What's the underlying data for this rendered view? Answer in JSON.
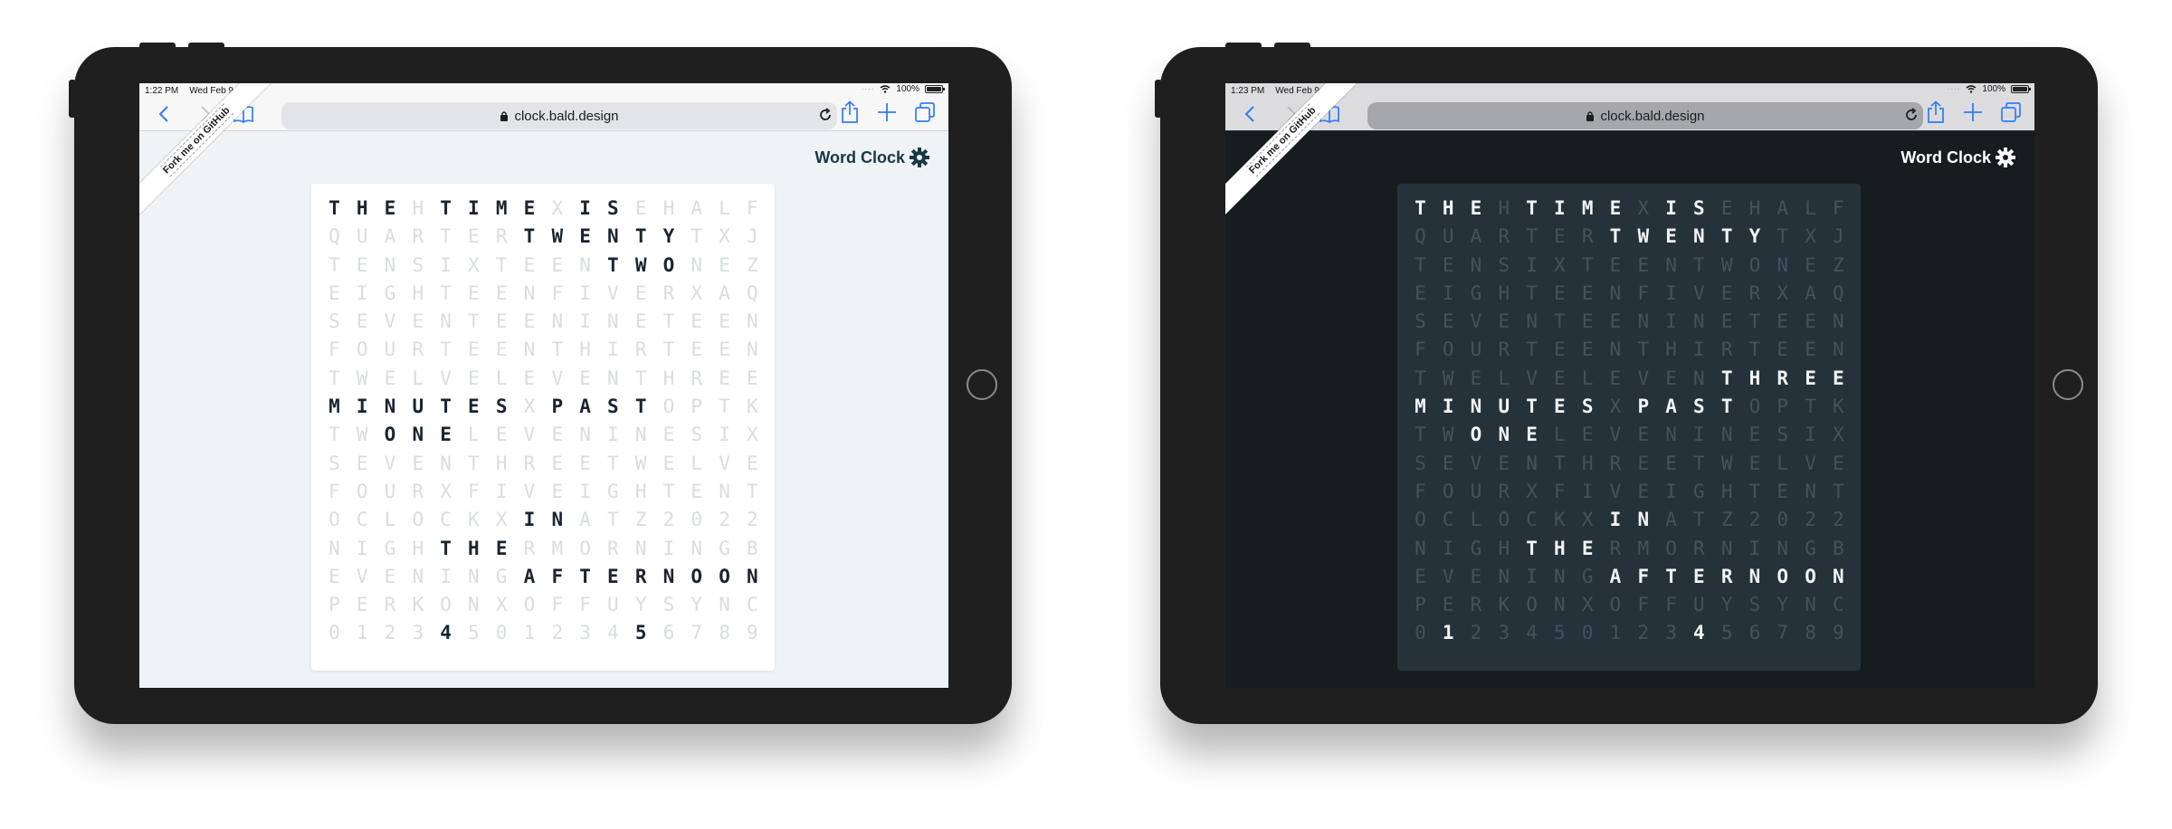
{
  "devices": [
    {
      "theme": "light",
      "status": {
        "time": "1:22 PM",
        "date": "Wed Feb 9",
        "battery": "100%"
      },
      "url": "clock.bald.design",
      "banner": "Fork me on GitHub",
      "app_title": "Word Clock",
      "grid": [
        "THEHTIMEXISEHALF",
        "QUARTERTWENTYTXJ",
        "TENSIXTEENTWONEZ",
        "EIGHTEENFIVERXAQ",
        "SEVENTEENINETEEN",
        "FOURTEENTHIRTEEN",
        "TWELVELEVENTHREE",
        "MINUTESXPASTOPTK",
        "TWONELEVENINESIX",
        "SEVENTHREETWELVE",
        "FOURXFIVEIGHTENT",
        "OCLOCKXINATZ2022",
        "NIGHTHERMORNINGB",
        "EVENINGAFTERNOON",
        "PERKONXOFFUYSYNC",
        "0123450123456789"
      ],
      "lit": [
        [
          0,
          0
        ],
        [
          0,
          1
        ],
        [
          0,
          2
        ],
        [
          0,
          4
        ],
        [
          0,
          5
        ],
        [
          0,
          6
        ],
        [
          0,
          7
        ],
        [
          0,
          9
        ],
        [
          0,
          10
        ],
        [
          1,
          7
        ],
        [
          1,
          8
        ],
        [
          1,
          9
        ],
        [
          1,
          10
        ],
        [
          1,
          11
        ],
        [
          1,
          12
        ],
        [
          2,
          10
        ],
        [
          2,
          11
        ],
        [
          2,
          12
        ],
        [
          7,
          0
        ],
        [
          7,
          1
        ],
        [
          7,
          2
        ],
        [
          7,
          3
        ],
        [
          7,
          4
        ],
        [
          7,
          5
        ],
        [
          7,
          6
        ],
        [
          7,
          8
        ],
        [
          7,
          9
        ],
        [
          7,
          10
        ],
        [
          7,
          11
        ],
        [
          8,
          2
        ],
        [
          8,
          3
        ],
        [
          8,
          4
        ],
        [
          11,
          7
        ],
        [
          11,
          8
        ],
        [
          12,
          4
        ],
        [
          12,
          5
        ],
        [
          12,
          6
        ],
        [
          13,
          7
        ],
        [
          13,
          8
        ],
        [
          13,
          9
        ],
        [
          13,
          10
        ],
        [
          13,
          11
        ],
        [
          13,
          12
        ],
        [
          13,
          13
        ],
        [
          13,
          14
        ],
        [
          13,
          15
        ],
        [
          15,
          4
        ],
        [
          15,
          11
        ]
      ]
    },
    {
      "theme": "dark",
      "status": {
        "time": "1:23 PM",
        "date": "Wed Feb 9",
        "battery": "100%"
      },
      "url": "clock.bald.design",
      "banner": "Fork me on GitHub",
      "app_title": "Word Clock",
      "grid": [
        "THEHTIMEXISEHALF",
        "QUARTERTWENTYTXJ",
        "TENSIXTEENTWONEZ",
        "EIGHTEENFIVERXAQ",
        "SEVENTEENINETEEN",
        "FOURTEENTHIRTEEN",
        "TWELVELEVENTHREE",
        "MINUTESXPASTOPTK",
        "TWONELEVENINESIX",
        "SEVENTHREETWELVE",
        "FOURXFIVEIGHTENT",
        "OCLOCKXINATZ2022",
        "NIGHTHERMORNINGB",
        "EVENINGAFTERNOON",
        "PERKONXOFFUYSYNC",
        "0123450123456789"
      ],
      "lit": [
        [
          0,
          0
        ],
        [
          0,
          1
        ],
        [
          0,
          2
        ],
        [
          0,
          4
        ],
        [
          0,
          5
        ],
        [
          0,
          6
        ],
        [
          0,
          7
        ],
        [
          0,
          9
        ],
        [
          0,
          10
        ],
        [
          1,
          7
        ],
        [
          1,
          8
        ],
        [
          1,
          9
        ],
        [
          1,
          10
        ],
        [
          1,
          11
        ],
        [
          1,
          12
        ],
        [
          6,
          11
        ],
        [
          6,
          12
        ],
        [
          6,
          13
        ],
        [
          6,
          14
        ],
        [
          6,
          15
        ],
        [
          7,
          0
        ],
        [
          7,
          1
        ],
        [
          7,
          2
        ],
        [
          7,
          3
        ],
        [
          7,
          4
        ],
        [
          7,
          5
        ],
        [
          7,
          6
        ],
        [
          7,
          8
        ],
        [
          7,
          9
        ],
        [
          7,
          10
        ],
        [
          7,
          11
        ],
        [
          8,
          2
        ],
        [
          8,
          3
        ],
        [
          8,
          4
        ],
        [
          11,
          7
        ],
        [
          11,
          8
        ],
        [
          12,
          4
        ],
        [
          12,
          5
        ],
        [
          12,
          6
        ],
        [
          13,
          7
        ],
        [
          13,
          8
        ],
        [
          13,
          9
        ],
        [
          13,
          10
        ],
        [
          13,
          11
        ],
        [
          13,
          12
        ],
        [
          13,
          13
        ],
        [
          13,
          14
        ],
        [
          13,
          15
        ],
        [
          15,
          1
        ],
        [
          15,
          10
        ]
      ]
    }
  ],
  "colors": {
    "light_bg": "#eff3f6",
    "light_lit": "#1a2430",
    "light_dim": "#d8dde1",
    "dark_bg": "#171c1e",
    "dark_board": "#25323a",
    "dark_lit": "#f2f4f5",
    "dark_dim": "#44535b",
    "safari_blue": "#2f7cf6"
  },
  "icons": [
    "back-icon",
    "forward-icon",
    "bookmarks-icon",
    "lock-icon",
    "reload-icon",
    "share-icon",
    "plus-icon",
    "tabs-icon",
    "wifi-icon",
    "battery-icon",
    "gear-icon"
  ]
}
